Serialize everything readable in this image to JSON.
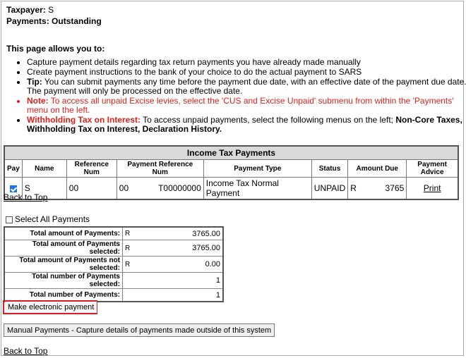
{
  "header": {
    "taxpayer_label": "Taxpayer:",
    "taxpayer_value": "S",
    "payments_label": "Payments:",
    "payments_value": "Outstanding"
  },
  "intro": {
    "heading": "This page allows you to:",
    "bullet1": "Capture payment details regarding tax return payments you have already made manually",
    "bullet2": "Create payment instructions to the bank of your choice to do the actual payment to SARS",
    "tip_label": "Tip:",
    "tip_text": " You can submit payments any time before the payment due date, with an effective date of the payment due date. The payment will only be processed on the effective date.",
    "note_label": "Note:",
    "note_text": " To access all unpaid Excise levies, select the 'CUS and Excise Unpaid' submenu from within the 'Payments' menu on the left.",
    "wt_label": "Withholding Tax on Interest:",
    "wt_text": " To access unpaid payments, select the following menus on the left; ",
    "wt_bold": "Non-Core Taxes, Withholding Tax on Interest, Declaration History."
  },
  "income_table": {
    "caption": "Income Tax Payments",
    "columns": [
      "Pay",
      "Name",
      "Reference Num",
      "Payment Reference Num",
      "Payment Type",
      "Status",
      "Amount Due",
      "Payment Advice"
    ],
    "row": {
      "pay_checked": true,
      "name": "S",
      "reference_num": "00",
      "payment_ref_prefix": "00",
      "payment_ref_suffix": "T00000000",
      "payment_type": "Income Tax Normal Payment",
      "status": "UNPAID",
      "currency": "R",
      "amount_due": "3765",
      "advice": "Print"
    }
  },
  "back_to_top": "Back to Top",
  "select_all": {
    "label": "Select All Payments",
    "checked": false
  },
  "totals": [
    {
      "label": "Total amount of Payments:",
      "currency": "R",
      "value": "3765.00"
    },
    {
      "label": "Total amount of Payments selected:",
      "currency": "R",
      "value": "3765.00"
    },
    {
      "label": "Total amount of Payments not selected:",
      "currency": "R",
      "value": "0.00"
    },
    {
      "label": "Total number of Payments selected:",
      "currency": "",
      "value": "1"
    },
    {
      "label": "Total number of Payments:",
      "currency": "",
      "value": "1"
    }
  ],
  "buttons": {
    "electronic": "Make electronic payment",
    "manual": "Manual Payments - Capture details of payments made outside of this system"
  },
  "colors": {
    "highlight": "#d0202a",
    "note_red": "#e0201b",
    "checkbox_blue": "#1a73e8",
    "caption_bg": "#d9d9d9"
  }
}
